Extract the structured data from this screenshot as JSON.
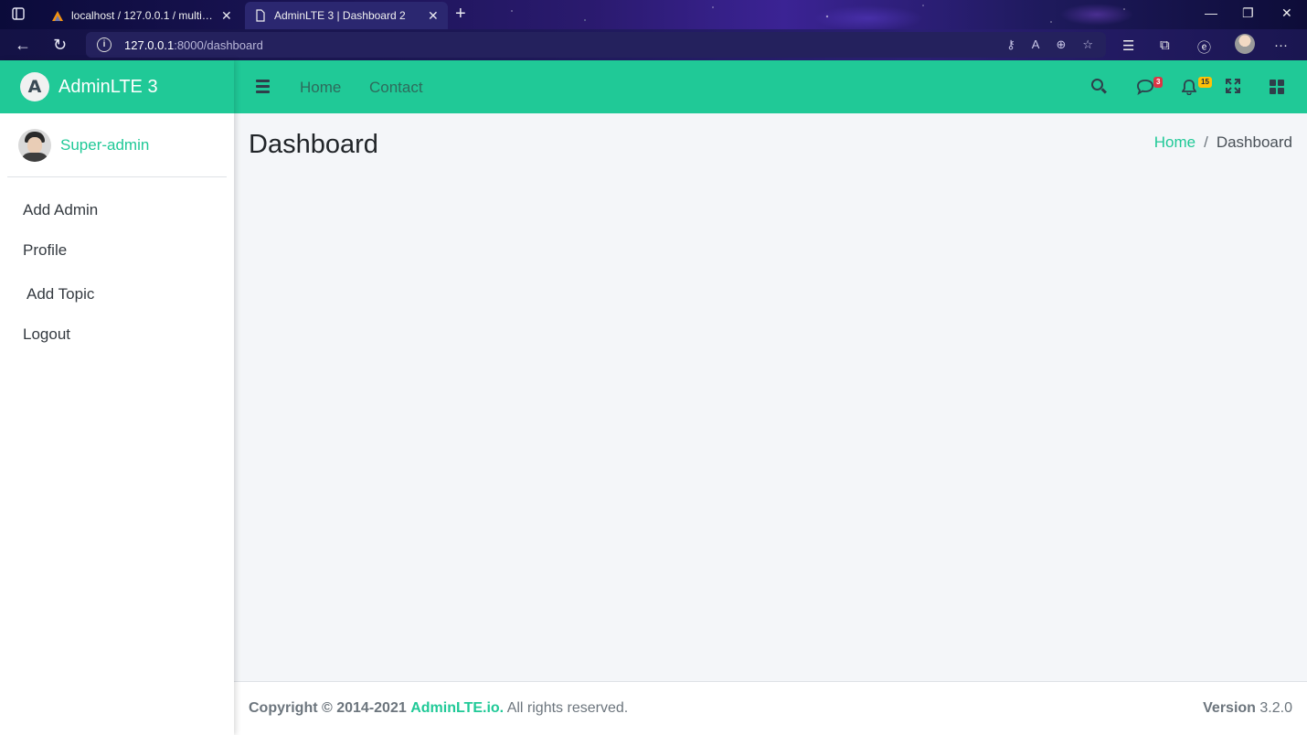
{
  "browser": {
    "tabs": [
      {
        "title": "localhost / 127.0.0.1 / multiuserlo",
        "active": false
      },
      {
        "title": "AdminLTE 3 | Dashboard 2",
        "active": true
      }
    ],
    "url_host": "127.0.0.1",
    "url_path": ":8000/dashboard",
    "icons": [
      "sidebar-toggle-icon",
      "back-icon",
      "reload-icon",
      "info-icon",
      "key-icon",
      "read-aloud-icon",
      "zoom-icon",
      "favorite-add-icon",
      "favorites-icon",
      "collections-icon",
      "edge-icon",
      "profile-icon",
      "more-icon",
      "minimize-icon",
      "restore-icon",
      "close-icon",
      "new-tab-icon"
    ]
  },
  "brand": {
    "logo_letter": "A",
    "name": "AdminLTE 3"
  },
  "user": {
    "name": "Super-admin"
  },
  "sidebar": {
    "items": [
      {
        "label": "Add Admin"
      },
      {
        "label": "Profile"
      },
      {
        "label": "Add Topic"
      },
      {
        "label": "Logout"
      }
    ]
  },
  "topnav": {
    "links": [
      {
        "label": "Home"
      },
      {
        "label": "Contact"
      }
    ],
    "messages_badge": "3",
    "notifications_badge": "15"
  },
  "content": {
    "title": "Dashboard",
    "breadcrumb": {
      "home": "Home",
      "separator": "/",
      "current": "Dashboard"
    }
  },
  "footer": {
    "copyright": "Copyright © 2014-2021",
    "link": "AdminLTE.io.",
    "rights": "All rights reserved.",
    "version_label": "Version",
    "version": "3.2.0"
  },
  "colors": {
    "accent": "#20c997",
    "text_dark": "#343a40",
    "background": "#f4f6f9"
  }
}
